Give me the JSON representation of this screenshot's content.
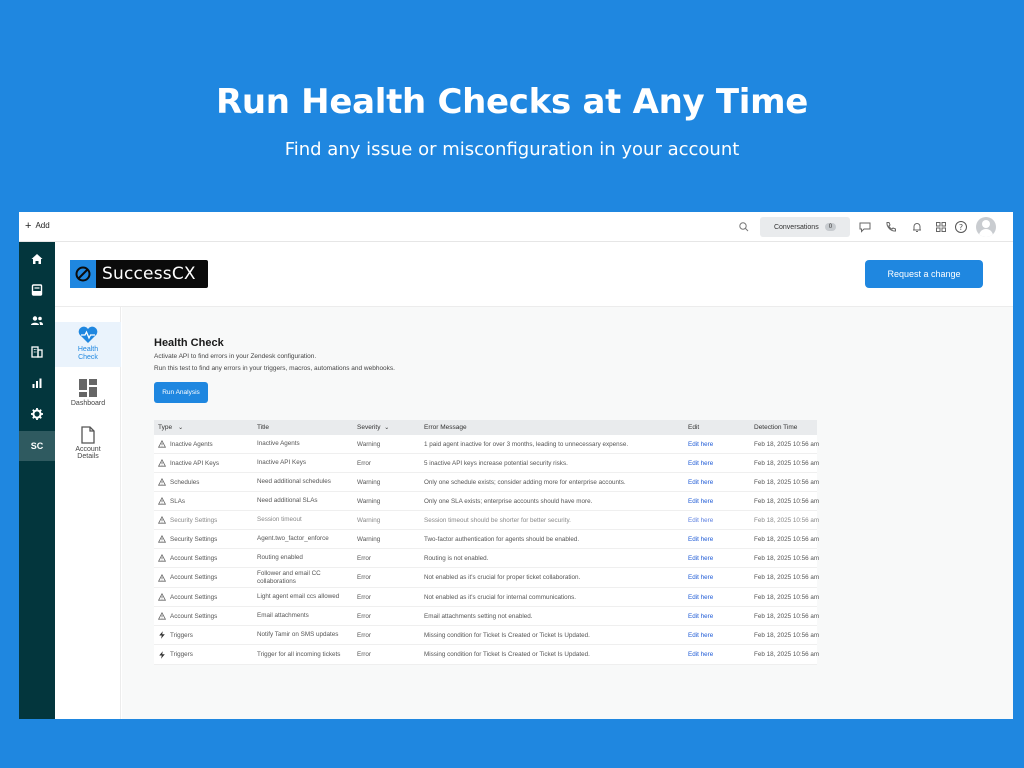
{
  "hero": {
    "title": "Run Health Checks at Any Time",
    "subtitle": "Find any issue or misconfiguration in your account"
  },
  "topbar": {
    "add_label": "Add",
    "conversations_label": "Conversations",
    "conversations_count": "0"
  },
  "sidebar": {
    "app_badge": "SC"
  },
  "app": {
    "logo_text": "SuccessCX",
    "request_button": "Request a change"
  },
  "nav": {
    "health_check": "Health Check",
    "dashboard": "Dashboard",
    "account_details": "Account Details"
  },
  "health_check": {
    "title": "Health Check",
    "desc1": "Activate API to find errors in your Zendesk configuration.",
    "desc2": "Run this test to find any errors in your triggers, macros, automations and webhooks.",
    "run_button": "Run Analysis"
  },
  "table": {
    "headers": {
      "type": "Type",
      "title": "Title",
      "severity": "Severity",
      "error": "Error Message",
      "edit": "Edit",
      "time": "Detection Time"
    },
    "rows": [
      {
        "icon": "warning-icon",
        "type": "Inactive Agents",
        "title": "Inactive Agents",
        "severity": "Warning",
        "error": "1 paid agent inactive for over 3 months, leading to unnecessary expense.",
        "edit": "Edit here",
        "time": "Feb 18, 2025 10:56 am"
      },
      {
        "icon": "warning-icon",
        "type": "Inactive API Keys",
        "title": "Inactive API Keys",
        "severity": "Error",
        "error": "5 inactive API keys increase potential security risks.",
        "edit": "Edit here",
        "time": "Feb 18, 2025 10:56 am"
      },
      {
        "icon": "warning-icon",
        "type": "Schedules",
        "title": "Need additional schedules",
        "severity": "Warning",
        "error": "Only one schedule exists; consider adding more for enterprise accounts.",
        "edit": "Edit here",
        "time": "Feb 18, 2025 10:56 am"
      },
      {
        "icon": "warning-icon",
        "type": "SLAs",
        "title": "Need additional SLAs",
        "severity": "Warning",
        "error": "Only one SLA exists; enterprise accounts should have more.",
        "edit": "Edit here",
        "time": "Feb 18, 2025 10:56 am"
      },
      {
        "icon": "warning-icon",
        "type": "Security Settings",
        "title": "Session timeout",
        "severity": "Warning",
        "error": "Session timeout should be shorter for better security.",
        "edit": "Edit here",
        "time": "Feb 18, 2025 10:56 am"
      },
      {
        "icon": "warning-icon",
        "type": "Security Settings",
        "title": "Agent.two_factor_enforce",
        "severity": "Warning",
        "error": "Two-factor authentication for agents should be enabled.",
        "edit": "Edit here",
        "time": "Feb 18, 2025 10:56 am"
      },
      {
        "icon": "warning-icon",
        "type": "Account Settings",
        "title": "Routing enabled",
        "severity": "Error",
        "error": "Routing is not enabled.",
        "edit": "Edit here",
        "time": "Feb 18, 2025 10:56 am"
      },
      {
        "icon": "warning-icon",
        "type": "Account Settings",
        "title": "Follower and email CC collaborations",
        "severity": "Error",
        "error": "Not enabled as it's crucial for proper ticket collaboration.",
        "edit": "Edit here",
        "time": "Feb 18, 2025 10:56 am"
      },
      {
        "icon": "warning-icon",
        "type": "Account Settings",
        "title": "Light agent email ccs allowed",
        "severity": "Error",
        "error": "Not enabled as it's crucial for internal communications.",
        "edit": "Edit here",
        "time": "Feb 18, 2025 10:56 am"
      },
      {
        "icon": "warning-icon",
        "type": "Account Settings",
        "title": "Email attachments",
        "severity": "Error",
        "error": "Email attachments setting not enabled.",
        "edit": "Edit here",
        "time": "Feb 18, 2025 10:56 am"
      },
      {
        "icon": "lightning-icon",
        "type": "Triggers",
        "title": "Notify Tamir on SMS updates",
        "severity": "Error",
        "error": "Missing condition for Ticket Is Created or Ticket Is Updated.",
        "edit": "Edit here",
        "time": "Feb 18, 2025 10:56 am"
      },
      {
        "icon": "lightning-icon",
        "type": "Triggers",
        "title": "Trigger for all incoming tickets",
        "severity": "Error",
        "error": "Missing condition for Ticket Is Created or Ticket Is Updated.",
        "edit": "Edit here",
        "time": "Feb 18, 2025 10:56 am"
      }
    ]
  },
  "colors": {
    "background": "#1f87e0",
    "sidebar": "#03363d",
    "accent": "#1f87e0",
    "link": "#1f5bd6"
  }
}
